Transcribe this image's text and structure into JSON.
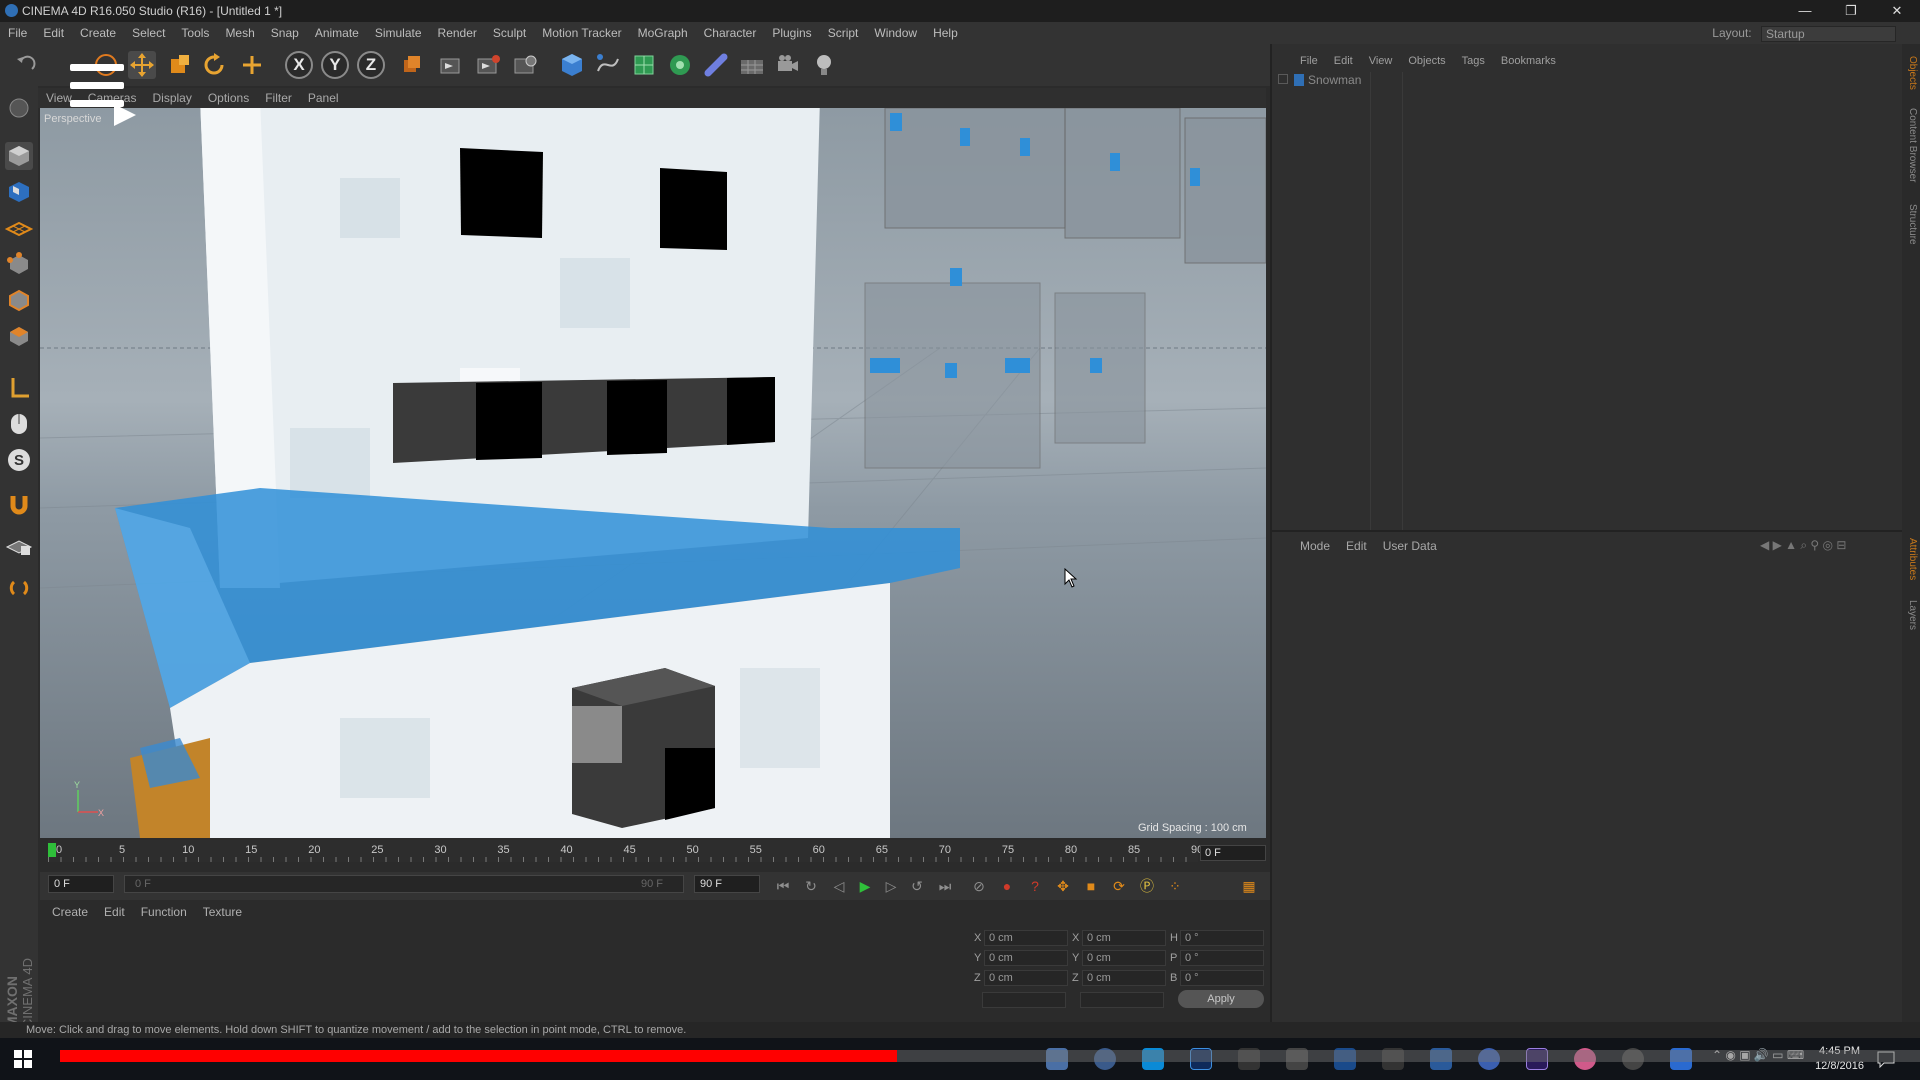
{
  "window": {
    "title": "CINEMA 4D R16.050 Studio (R16) - [Untitled 1 *]",
    "minimize": "—",
    "restore": "❐",
    "close": "✕"
  },
  "menubar": {
    "items": [
      "File",
      "Edit",
      "Create",
      "Select",
      "Tools",
      "Mesh",
      "Snap",
      "Animate",
      "Simulate",
      "Render",
      "Sculpt",
      "Motion Tracker",
      "MoGraph",
      "Character",
      "Plugins",
      "Script",
      "Window",
      "Help"
    ],
    "layout_label": "Layout:",
    "layout_value": "Startup"
  },
  "toolbar": {
    "axis_x": "X",
    "axis_y": "Y",
    "axis_z": "Z"
  },
  "viewport": {
    "menu": [
      "View",
      "Cameras",
      "Display",
      "Options",
      "Filter",
      "Panel"
    ],
    "camera_label": "Perspective",
    "grid_spacing": "Grid Spacing : 100 cm",
    "axis_y": "Y",
    "axis_x": "X"
  },
  "timeline": {
    "ticks": [
      "0",
      "5",
      "10",
      "15",
      "20",
      "25",
      "30",
      "35",
      "40",
      "45",
      "50",
      "55",
      "60",
      "65",
      "70",
      "75",
      "80",
      "85",
      "90"
    ],
    "current_frame": "0 F",
    "start_field": "0 F",
    "end_field": "90 F",
    "range_start": "0 F",
    "range_end": "90 F"
  },
  "material_manager": {
    "menu": [
      "Create",
      "Edit",
      "Function",
      "Texture"
    ]
  },
  "coordinates": {
    "rows": [
      {
        "l1": "X",
        "v1": "0 cm",
        "l2": "X",
        "v2": "0 cm",
        "l3": "H",
        "v3": "0 °"
      },
      {
        "l1": "Y",
        "v1": "0 cm",
        "l2": "Y",
        "v2": "0 cm",
        "l3": "P",
        "v3": "0 °"
      },
      {
        "l1": "Z",
        "v1": "0 cm",
        "l2": "Z",
        "v2": "0 cm",
        "l3": "B",
        "v3": "0 °"
      }
    ],
    "apply_label": "Apply"
  },
  "object_manager": {
    "menu": [
      "File",
      "Edit",
      "View",
      "Objects",
      "Tags",
      "Bookmarks"
    ],
    "object_name": "Snowman"
  },
  "attribute_manager": {
    "menu": [
      "Mode",
      "Edit",
      "User Data"
    ]
  },
  "side_tabs": {
    "top": [
      "Objects",
      "Content Browser",
      "Structure"
    ],
    "bottom": [
      "Attributes",
      "Layers"
    ]
  },
  "status": {
    "text": "Move: Click and drag to move elements. Hold down SHIFT to quantize movement / add to the selection in point mode, CTRL to remove.",
    "brand_1": "MAXON",
    "brand_2": "CINEMA 4D"
  },
  "video_progress": 0.45,
  "taskbar": {
    "time": "4:45 PM",
    "date": "12/8/2016"
  },
  "colors": {
    "accent_blue": "#2f8fd8",
    "progress_red": "#ff0000",
    "playhead_green": "#2fbf3a"
  }
}
